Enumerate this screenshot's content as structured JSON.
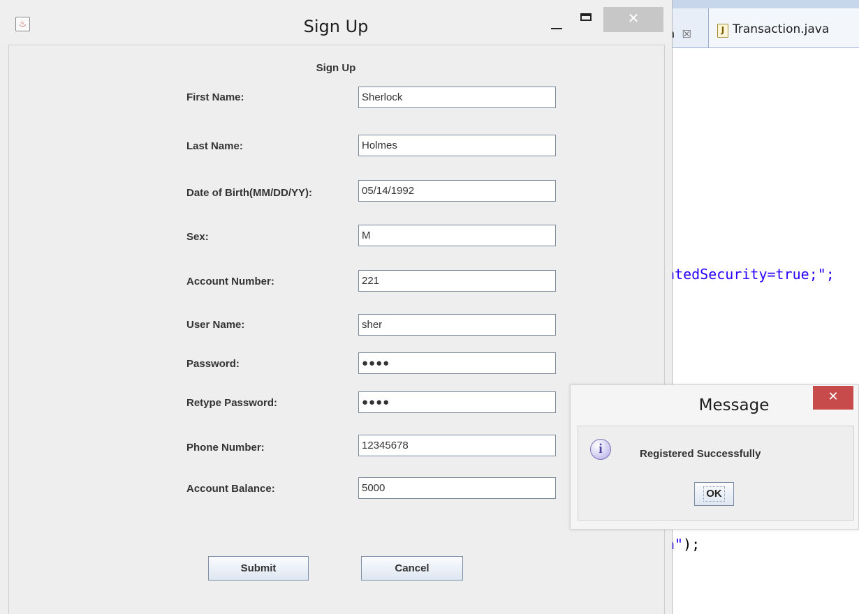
{
  "ide": {
    "inactive_tab_fragment": "a",
    "inactive_tab_close": "☒",
    "active_tab_icon": "java-file-icon",
    "active_tab_label": "Transaction.java",
    "code_line_1": "atedSecurity=true;\";",
    "code_line_2_string": "n\"",
    "code_line_2_rest": ");"
  },
  "signup_window": {
    "title": "Sign Up",
    "heading": "Sign Up",
    "icons": {
      "app": "java-app-icon",
      "minimize": "minimize-icon",
      "maximize": "maximize-icon",
      "close": "close-icon"
    },
    "close_glyph": "✕",
    "fields": {
      "first_name": {
        "label": "First Name:",
        "value": "Sherlock"
      },
      "last_name": {
        "label": "Last Name:",
        "value": "Holmes"
      },
      "dob": {
        "label": "Date of Birth(MM/DD/YY):",
        "value": "05/14/1992"
      },
      "sex": {
        "label": "Sex:",
        "value": "M"
      },
      "account_number": {
        "label": "Account Number:",
        "value": "221"
      },
      "user_name": {
        "label": "User Name:",
        "value": "sher"
      },
      "password": {
        "label": "Password:",
        "value": "●●●●"
      },
      "retype_password": {
        "label": "Retype Password:",
        "value": "●●●●"
      },
      "phone_number": {
        "label": "Phone Number:",
        "value": "12345678"
      },
      "account_balance": {
        "label": "Account Balance:",
        "value": "5000"
      }
    },
    "buttons": {
      "submit": "Submit",
      "cancel": "Cancel"
    }
  },
  "message_dialog": {
    "title": "Message",
    "close_glyph": "✕",
    "icon": "info-icon",
    "icon_glyph": "i",
    "text": "Registered Successfully",
    "ok": "OK"
  }
}
